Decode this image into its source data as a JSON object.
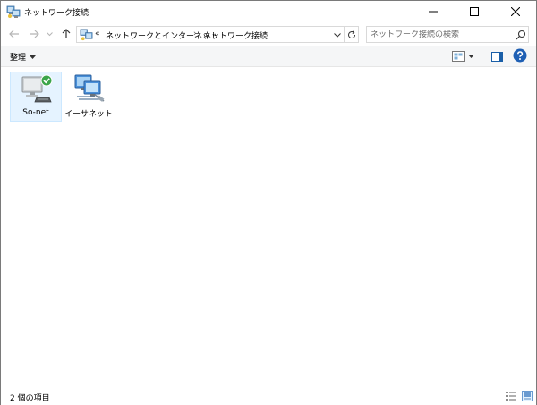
{
  "window": {
    "title": "ネットワーク接続"
  },
  "navigation": {
    "address_prefix": "«",
    "breadcrumbs": [
      {
        "label": "ネットワークとインターネット"
      },
      {
        "label": "ネットワーク接続"
      }
    ],
    "separator": "›",
    "search_placeholder": "ネットワーク接続の検索"
  },
  "command_bar": {
    "organize_label": "整理"
  },
  "items": [
    {
      "label": "So-net",
      "icon": "dialup-connection-icon",
      "status": "connected"
    },
    {
      "label": "イーサネット",
      "icon": "ethernet-connection-icon",
      "status": "normal"
    }
  ],
  "status_bar": {
    "item_count": "2 個の項目"
  },
  "colors": {
    "accent": "#0078d7",
    "selection_bg": "#e5f3ff",
    "selection_border": "#cce8ff",
    "check_green": "#3ba54a"
  }
}
